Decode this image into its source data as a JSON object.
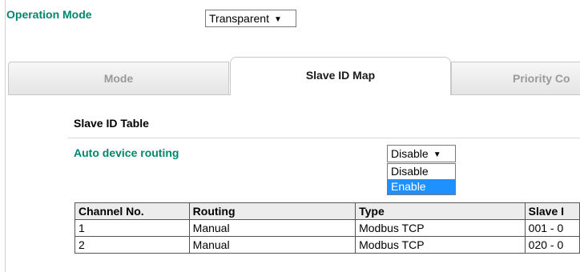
{
  "operation_mode": {
    "label": "Operation Mode",
    "value": "Transparent",
    "arrow": "▼"
  },
  "tabs": [
    {
      "label": "Mode",
      "active": false
    },
    {
      "label": "Slave ID Map",
      "active": true
    },
    {
      "label": "Priority Co",
      "active": false
    }
  ],
  "section": {
    "title": "Slave ID Table"
  },
  "auto_routing": {
    "label": "Auto device routing",
    "value": "Disable",
    "arrow": "▼",
    "options": [
      "Disable",
      "Enable"
    ],
    "highlighted_option": "Enable"
  },
  "table": {
    "headers": [
      "Channel No.",
      "Routing",
      "Type",
      "Slave I"
    ],
    "rows": [
      [
        "1",
        "Manual",
        "Modbus TCP",
        "001 - 0"
      ],
      [
        "2",
        "Manual",
        "Modbus TCP",
        "020 - 0"
      ]
    ]
  },
  "colors": {
    "accent_label": "#00866c",
    "selection": "#1e90ff"
  }
}
